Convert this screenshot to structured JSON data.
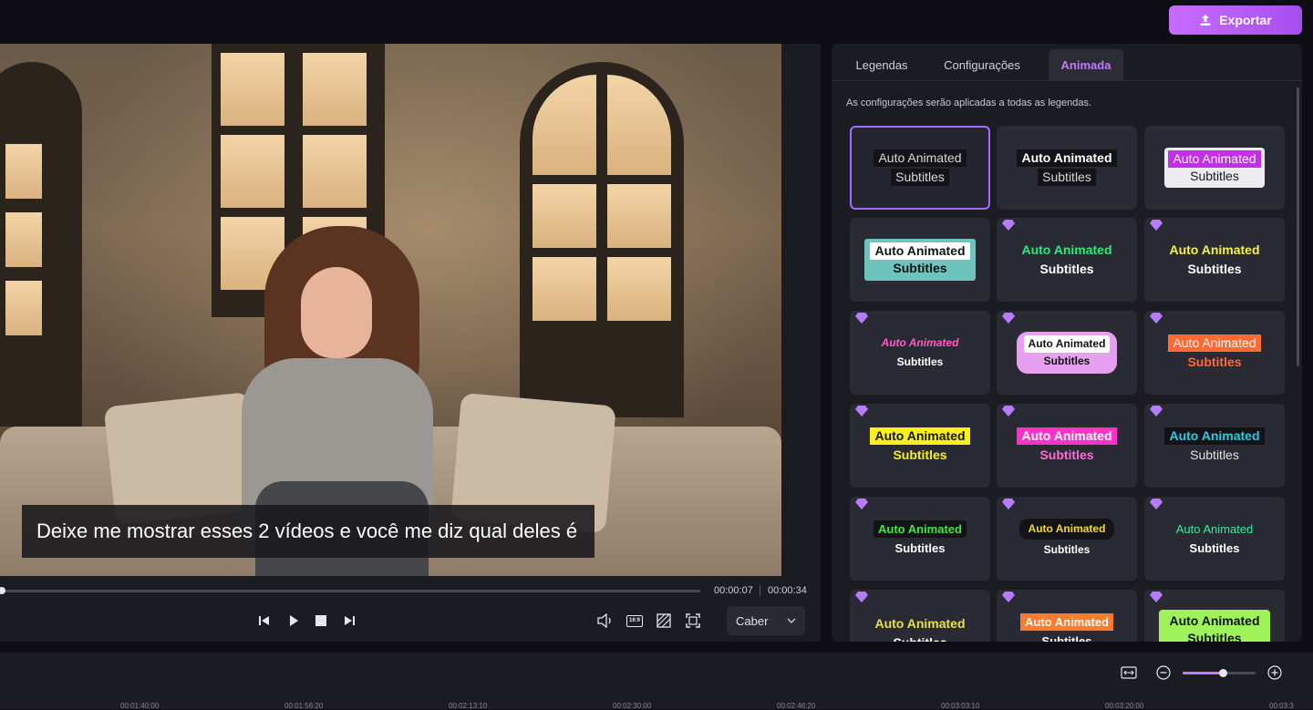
{
  "header": {
    "export_label": "Exportar"
  },
  "player": {
    "caption": "Deixe me mostrar esses 2 vídeos e você me diz qual deles é",
    "time_current": "00:00:07",
    "time_total": "00:00:34",
    "fit_option": "Caber",
    "aspect_ratio_label": "16:9",
    "progress": 0.0
  },
  "panel": {
    "tabs": [
      {
        "label": "Legendas",
        "active": false
      },
      {
        "label": "Configurações",
        "active": false
      },
      {
        "label": "Animada",
        "active": true
      }
    ],
    "note": "As configurações serão aplicadas a todas as legendas.",
    "styles": [
      {
        "line1": "Auto Animated",
        "line2": "Subtitles",
        "premium": false,
        "selected": true
      },
      {
        "line1": "Auto Animated",
        "line2": "Subtitles",
        "premium": false,
        "selected": false
      },
      {
        "line1": "Auto Animated",
        "line2": "Subtitles",
        "premium": false,
        "selected": false
      },
      {
        "line1": "Auto Animated",
        "line2": "Subtitles",
        "premium": false,
        "selected": false
      },
      {
        "line1": "Auto Animated",
        "line2": "Subtitles",
        "premium": true,
        "selected": false
      },
      {
        "line1": "Auto Animated",
        "line2": "Subtitles",
        "premium": true,
        "selected": false
      },
      {
        "line1": "Auto Animated",
        "line2": "Subtitles",
        "premium": true,
        "selected": false
      },
      {
        "line1": "Auto Animated",
        "line2": "Subtitles",
        "premium": true,
        "selected": false
      },
      {
        "line1": "Auto Animated",
        "line2": "Subtitles",
        "premium": true,
        "selected": false
      },
      {
        "line1": "Auto Animated",
        "line2": "Subtitles",
        "premium": true,
        "selected": false
      },
      {
        "line1": "Auto Animated",
        "line2": "Subtitles",
        "premium": true,
        "selected": false
      },
      {
        "line1": "Auto Animated",
        "line2": "Subtitles",
        "premium": true,
        "selected": false
      },
      {
        "line1": "Auto Animated",
        "line2": "Subtitles",
        "premium": true,
        "selected": false
      },
      {
        "line1": "Auto Animated",
        "line2": "Subtitles",
        "premium": true,
        "selected": false
      },
      {
        "line1": "Auto Animated",
        "line2": "Subtitles",
        "premium": true,
        "selected": false
      },
      {
        "line1": "Auto Animated",
        "line2": "Subtitles",
        "premium": true,
        "selected": false
      },
      {
        "line1": "Auto Animated",
        "line2": "Subtitles",
        "premium": true,
        "selected": false
      },
      {
        "line1": "Auto Animated",
        "line2": "Subtitles",
        "premium": true,
        "selected": false
      }
    ]
  },
  "timeline": {
    "ticks": [
      "00:01:40:00",
      "00:01:56:20",
      "00:02:13:10",
      "00:02:30:00",
      "00:02:46:20",
      "00:03:03:10",
      "00:03:20:00",
      "00:03:3"
    ],
    "zoom_level": 0.55
  },
  "colors": {
    "accent": "#c279ff",
    "export_gradient_start": "#c86cff",
    "export_gradient_end": "#a64ef0",
    "premium_gem": "#b77bff"
  }
}
